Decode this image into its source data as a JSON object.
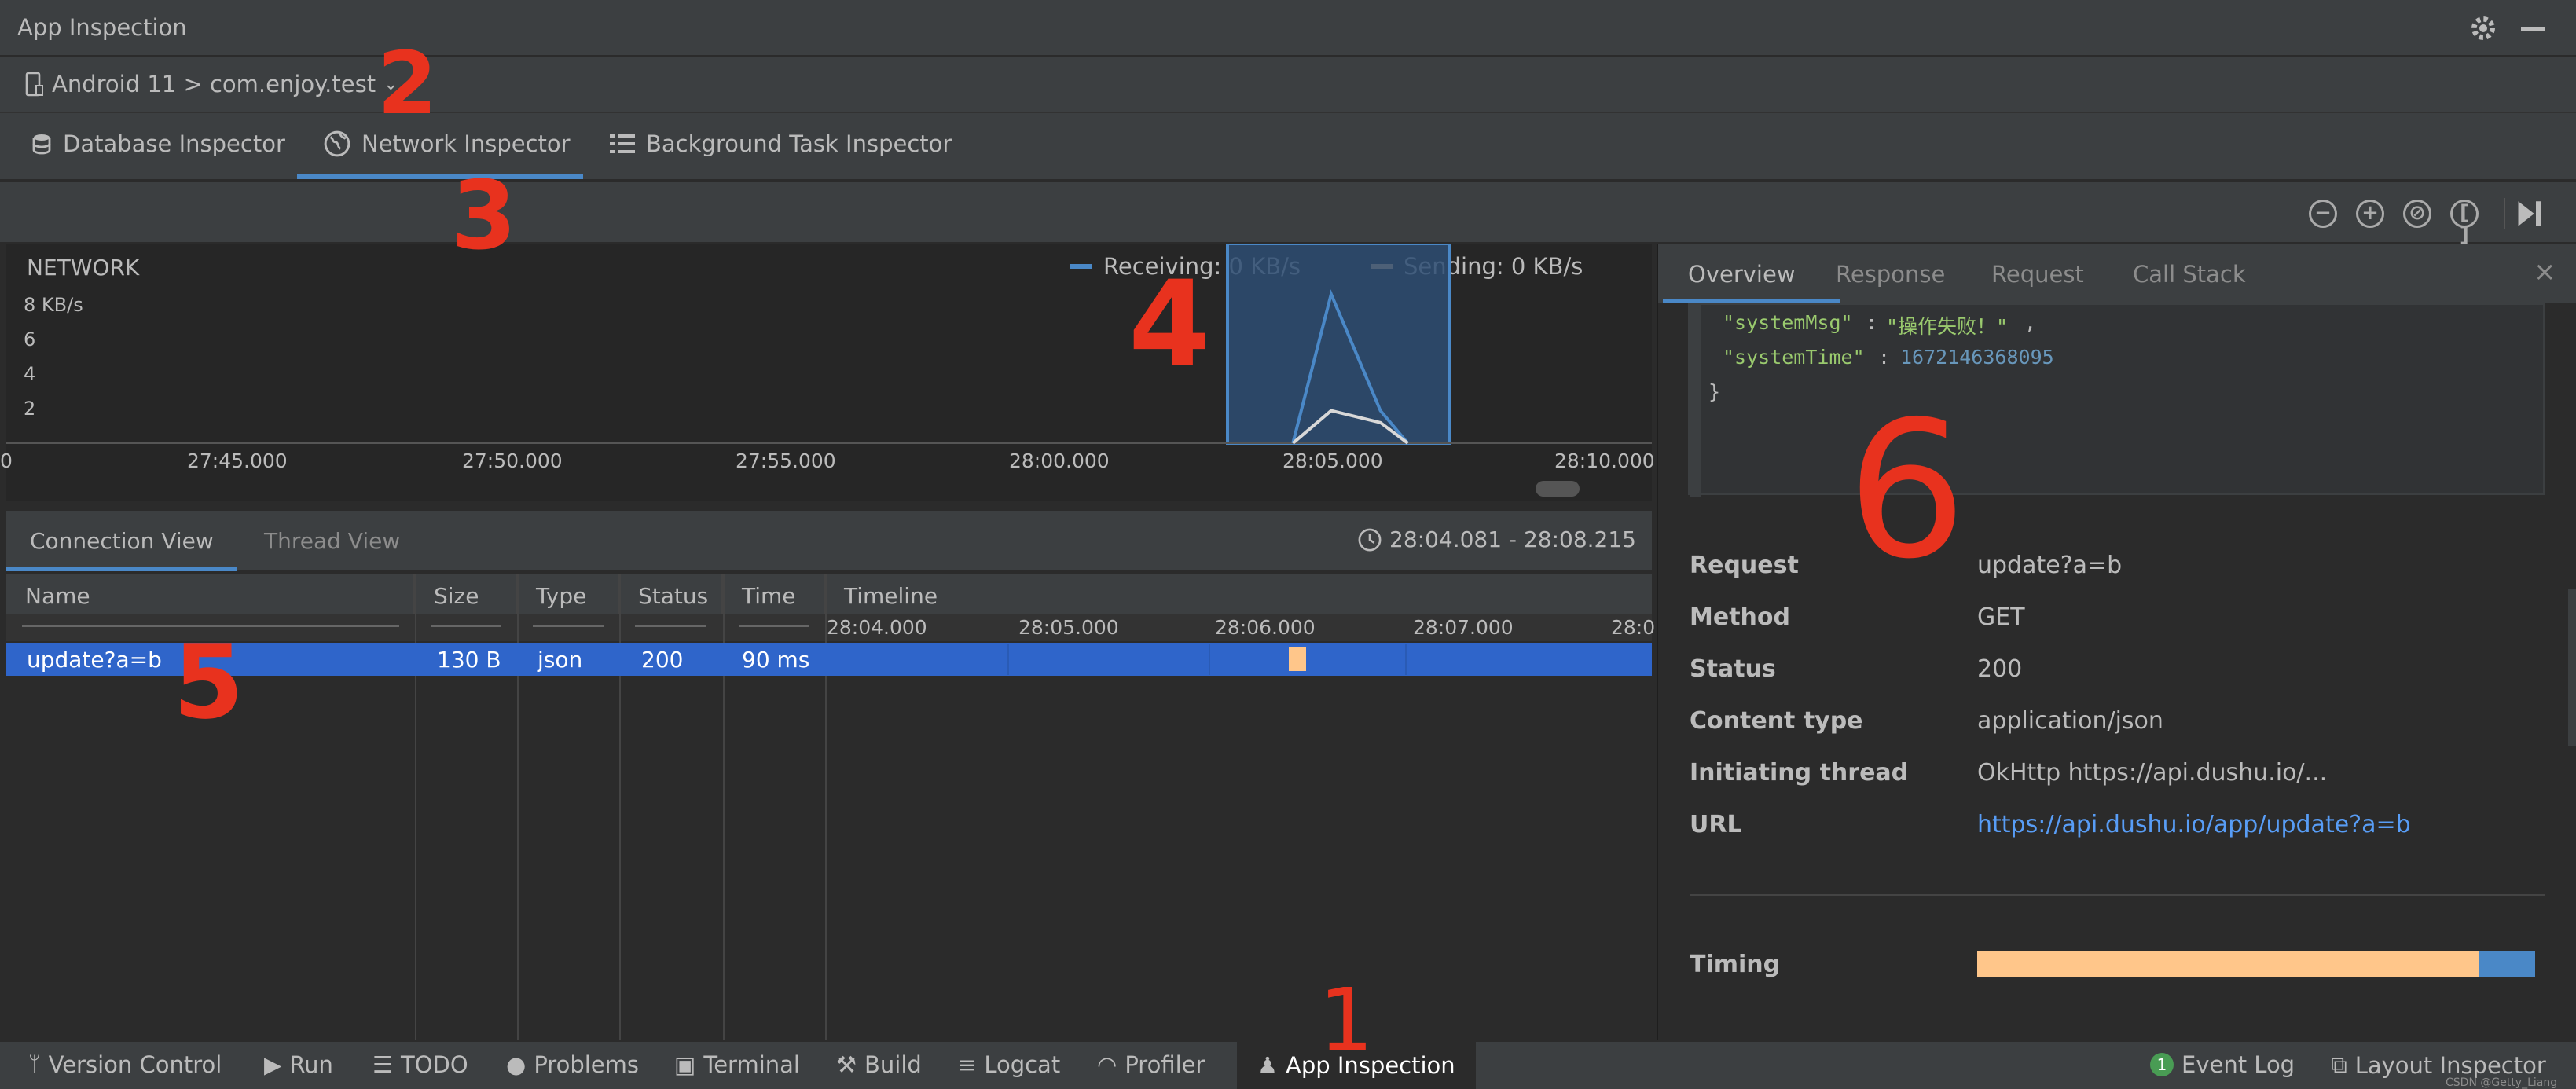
{
  "window": {
    "title": "App Inspection"
  },
  "device_selector": {
    "label": "Android 11 > com.enjoy.test"
  },
  "inspector_tabs": [
    {
      "label": "Database Inspector",
      "icon": "database-icon"
    },
    {
      "label": "Network Inspector",
      "icon": "globe-icon",
      "active": true
    },
    {
      "label": "Background Task Inspector",
      "icon": "list-icon"
    }
  ],
  "network_chart": {
    "title": "NETWORK",
    "legend": [
      {
        "label": "Receiving: 0 KB/s",
        "color": "#4a88c7"
      },
      {
        "label": "Sending: 0 KB/s",
        "color": "#ffc68a"
      }
    ],
    "y_ticks": [
      "8 KB/s",
      "6",
      "4",
      "2"
    ],
    "x_ticks": [
      "0",
      "27:45.000",
      "27:50.000",
      "27:55.000",
      "28:00.000",
      "28:05.000",
      "28:10.000"
    ]
  },
  "chart_data": {
    "type": "line",
    "title": "NETWORK",
    "xlabel": "",
    "ylabel": "",
    "ylim": [
      0,
      10
    ],
    "series": [
      {
        "name": "Receiving",
        "color": "#4a88c7",
        "x": [
          "28:04.500",
          "28:05.200",
          "28:06.100",
          "28:06.600"
        ],
        "values": [
          0,
          8.7,
          1.9,
          0
        ]
      },
      {
        "name": "Sending",
        "color": "#ffc68a",
        "x": [
          "28:04.500",
          "28:05.200",
          "28:06.100",
          "28:06.600"
        ],
        "values": [
          0,
          1.9,
          1.2,
          0
        ]
      }
    ],
    "selection_range": "28:04.081 - 28:08.215"
  },
  "connection_tabs": {
    "tabs": [
      {
        "label": "Connection View",
        "active": true
      },
      {
        "label": "Thread View"
      }
    ],
    "range_label": "28:04.081 - 28:08.215"
  },
  "table": {
    "headers": [
      "Name",
      "Size",
      "Type",
      "Status",
      "Time",
      "Timeline"
    ],
    "timeline_ticks": [
      "28:04.000",
      "28:05.000",
      "28:06.000",
      "28:07.000",
      "28:0"
    ],
    "rows": [
      {
        "name": "update?a=b",
        "size": "130 B",
        "type": "json",
        "status": "200",
        "time": "90 ms"
      }
    ]
  },
  "detail": {
    "tabs": [
      {
        "label": "Overview",
        "active": true
      },
      {
        "label": "Response"
      },
      {
        "label": "Request"
      },
      {
        "label": "Call Stack"
      }
    ],
    "json_lines": {
      "l1_key": "\"systemMsg\"",
      "l1_val": "\"操作失败！\"",
      "l2_key": "\"systemTime\"",
      "l2_val": "1672146368095",
      "l3": "}"
    },
    "fields": [
      {
        "label": "Request",
        "value": "update?a=b"
      },
      {
        "label": "Method",
        "value": "GET"
      },
      {
        "label": "Status",
        "value": "200"
      },
      {
        "label": "Content type",
        "value": "application/json"
      },
      {
        "label": "Initiating thread",
        "value": "OkHttp https://api.dushu.io/..."
      },
      {
        "label": "URL",
        "value": "https://api.dushu.io/app/update?a=b"
      }
    ],
    "timing": {
      "label": "Timing",
      "fraction": 0.9
    }
  },
  "statusbar": {
    "left": [
      {
        "label": "Version Control",
        "icon": "branch-icon"
      },
      {
        "label": "Run",
        "icon": "play-icon"
      },
      {
        "label": "TODO",
        "icon": "list-icon"
      },
      {
        "label": "Problems",
        "icon": "info-icon"
      },
      {
        "label": "Terminal",
        "icon": "terminal-icon"
      },
      {
        "label": "Build",
        "icon": "hammer-icon"
      },
      {
        "label": "Logcat",
        "icon": "logcat-icon"
      },
      {
        "label": "Profiler",
        "icon": "gauge-icon"
      },
      {
        "label": "App Inspection",
        "icon": "android-icon",
        "active": true
      }
    ],
    "right": [
      {
        "label": "Event Log",
        "badge": "1"
      },
      {
        "label": "Layout Inspector",
        "icon": "layout-icon"
      }
    ]
  },
  "annotations": [
    "1",
    "2",
    "3",
    "4",
    "5",
    "6"
  ],
  "watermark": "CSDN @Getty_Liang"
}
